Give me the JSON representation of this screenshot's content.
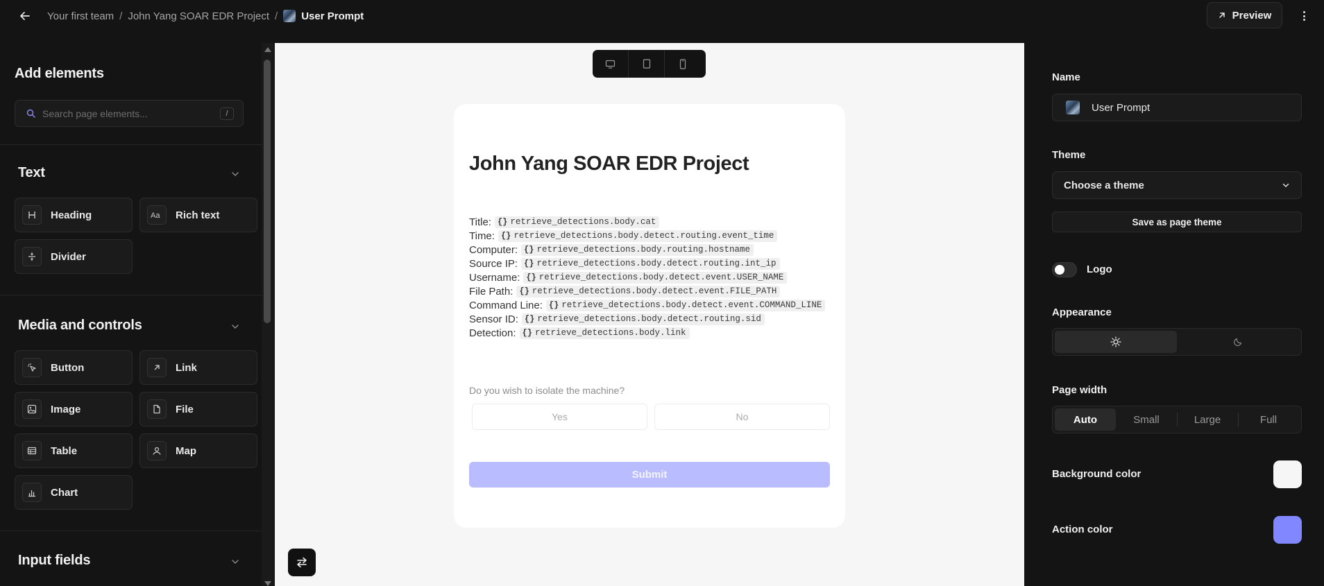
{
  "breadcrumb": {
    "items": [
      "Your first team",
      "John Yang SOAR EDR Project"
    ],
    "current": "User Prompt"
  },
  "topbar": {
    "preview_label": "Preview"
  },
  "left": {
    "title": "Add elements",
    "search_placeholder": "Search page elements...",
    "search_shortcut": "/",
    "sections": {
      "text": {
        "title": "Text",
        "items": [
          "Heading",
          "Rich text",
          "Divider"
        ]
      },
      "media": {
        "title": "Media and controls",
        "items": [
          "Button",
          "Link",
          "Image",
          "File",
          "Table",
          "Map",
          "Chart"
        ]
      },
      "input": {
        "title": "Input fields"
      }
    }
  },
  "card": {
    "title": "John Yang SOAR EDR Project",
    "fields": [
      {
        "label": "Title:",
        "value": "retrieve_detections.body.cat"
      },
      {
        "label": "Time:",
        "value": "retrieve_detections.body.detect.routing.event_time"
      },
      {
        "label": "Computer:",
        "value": "retrieve_detections.body.routing.hostname"
      },
      {
        "label": "Source IP:",
        "value": "retrieve_detections.body.detect.routing.int_ip"
      },
      {
        "label": "Username:",
        "value": "retrieve_detections.body.detect.event.USER_NAME"
      },
      {
        "label": "File Path:",
        "value": "retrieve_detections.body.detect.event.FILE_PATH"
      },
      {
        "label": "Command Line:",
        "value": "retrieve_detections.body.detect.event.COMMAND_LINE"
      },
      {
        "label": "Sensor ID:",
        "value": "retrieve_detections.body.detect.routing.sid"
      },
      {
        "label": "Detection:",
        "value": "retrieve_detections.body.link"
      }
    ],
    "question": "Do you wish to isolate the machine?",
    "options": [
      "Yes",
      "No"
    ],
    "submit_label": "Submit"
  },
  "right": {
    "name_label": "Name",
    "name_value": "User Prompt",
    "theme_label": "Theme",
    "theme_value": "Choose a theme",
    "save_theme_label": "Save as page theme",
    "logo_label": "Logo",
    "appearance_label": "Appearance",
    "page_width_label": "Page width",
    "page_width_options": [
      "Auto",
      "Small",
      "Large",
      "Full"
    ],
    "page_width_selected": "Auto",
    "background_color_label": "Background color",
    "background_color": "#f6f6f6",
    "action_color_label": "Action color",
    "action_color": "#8187ff"
  }
}
